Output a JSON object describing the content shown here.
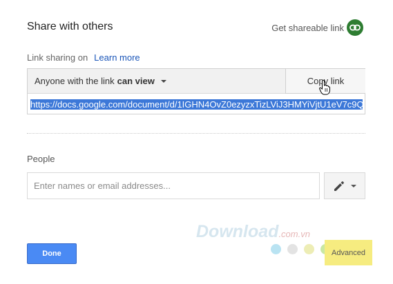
{
  "dialog": {
    "title": "Share with others",
    "get_shareable_link": "Get shareable link",
    "link_icon_color": "#2e7d32"
  },
  "sharing": {
    "label": "Link sharing on",
    "learn_more": "Learn more",
    "access_prefix": "Anyone with the link",
    "access_level": "can view",
    "copy_link": "Copy link",
    "url": "https://docs.google.com/document/d/1IGHN4OvZ0ezyzxTizLViJ3HMYiVjtU1eV7c9Q"
  },
  "people": {
    "label": "People",
    "placeholder": "Enter names or email addresses..."
  },
  "footer": {
    "done": "Done",
    "advanced": "Advanced"
  },
  "watermark": {
    "main": "Download",
    "sub": ".com.vn",
    "dot_colors": [
      "#b9e3f2",
      "#e3e3e3",
      "#ededb5",
      "#c9e8a3",
      "#8fc26a",
      "#f2a28c"
    ]
  },
  "colors": {
    "accent": "#4a8af4",
    "link": "#1a55b8",
    "selection": "#3c78d8",
    "highlight": "#f6ec80"
  }
}
